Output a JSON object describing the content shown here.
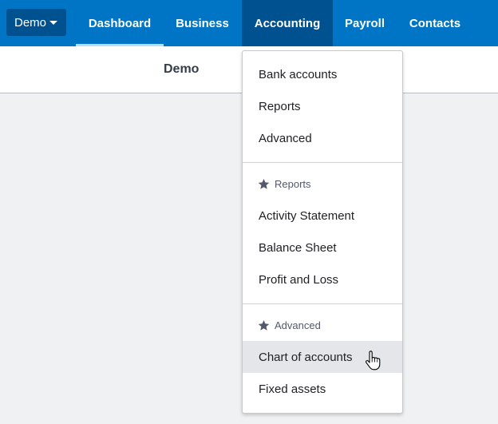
{
  "topnav": {
    "org_switcher": {
      "label": "Demo",
      "icon": "caret-down-icon"
    },
    "tabs": [
      {
        "label": "Dashboard",
        "active": true
      },
      {
        "label": "Business"
      },
      {
        "label": "Accounting",
        "open": true
      },
      {
        "label": "Payroll"
      },
      {
        "label": "Contacts"
      }
    ]
  },
  "subheader": {
    "title": "Demo"
  },
  "dropdown": {
    "items": [
      {
        "label": "Bank accounts"
      },
      {
        "label": "Reports"
      },
      {
        "label": "Advanced"
      }
    ],
    "sections": [
      {
        "label": "Reports",
        "icon": "star-icon",
        "items": [
          {
            "label": "Activity Statement"
          },
          {
            "label": "Balance Sheet"
          },
          {
            "label": "Profit and Loss"
          }
        ]
      },
      {
        "label": "Advanced",
        "icon": "star-icon",
        "items": [
          {
            "label": "Chart of accounts",
            "hovered": true
          },
          {
            "label": "Fixed assets"
          }
        ]
      }
    ]
  },
  "colors": {
    "nav_bg": "#0075c6",
    "nav_active_bg": "#00518f",
    "active_underline": "#bcdcf3",
    "page_bg": "#f0f1f3",
    "hover_bg": "#e4e6e9"
  }
}
